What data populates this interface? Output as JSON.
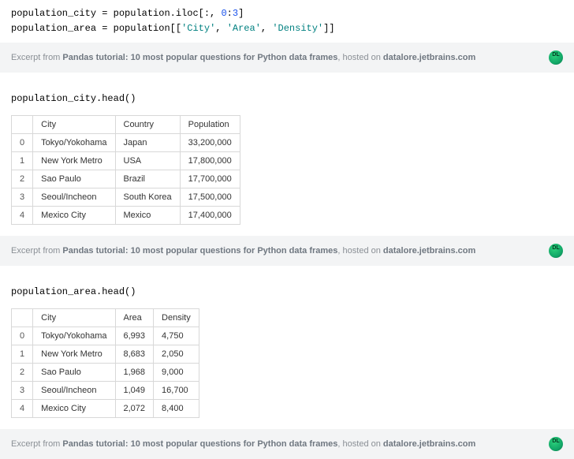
{
  "code_cell": {
    "line1_var": "population_city",
    "line1_assign": " = ",
    "line1_rhs_a": "population.iloc[:, ",
    "line1_num1": "0",
    "line1_colon": ":",
    "line1_num2": "3",
    "line1_rhs_b": "]",
    "line2_var": "population_area",
    "line2_assign": " = ",
    "line2_rhs_a": "population[[",
    "line2_str1": "'City'",
    "line2_c1": ", ",
    "line2_str2": "'Area'",
    "line2_c2": ", ",
    "line2_str3": "'Density'",
    "line2_rhs_b": "]]"
  },
  "footer": {
    "prefix": "Excerpt from ",
    "title": "Pandas tutorial: 10 most popular questions for Python data frames",
    "middle": ", hosted on ",
    "host": "datalore.jetbrains.com"
  },
  "block1": {
    "call": "population_city.head()",
    "columns": [
      "City",
      "Country",
      "Population"
    ],
    "rows": [
      {
        "idx": "0",
        "cells": [
          "Tokyo/Yokohama",
          "Japan",
          "33,200,000"
        ]
      },
      {
        "idx": "1",
        "cells": [
          "New York Metro",
          "USA",
          "17,800,000"
        ]
      },
      {
        "idx": "2",
        "cells": [
          "Sao Paulo",
          "Brazil",
          "17,700,000"
        ]
      },
      {
        "idx": "3",
        "cells": [
          "Seoul/Incheon",
          "South Korea",
          "17,500,000"
        ]
      },
      {
        "idx": "4",
        "cells": [
          "Mexico City",
          "Mexico",
          "17,400,000"
        ]
      }
    ]
  },
  "block2": {
    "call": "population_area.head()",
    "columns": [
      "City",
      "Area",
      "Density"
    ],
    "rows": [
      {
        "idx": "0",
        "cells": [
          "Tokyo/Yokohama",
          "6,993",
          "4,750"
        ]
      },
      {
        "idx": "1",
        "cells": [
          "New York Metro",
          "8,683",
          "2,050"
        ]
      },
      {
        "idx": "2",
        "cells": [
          "Sao Paulo",
          "1,968",
          "9,000"
        ]
      },
      {
        "idx": "3",
        "cells": [
          "Seoul/Incheon",
          "1,049",
          "16,700"
        ]
      },
      {
        "idx": "4",
        "cells": [
          "Mexico City",
          "2,072",
          "8,400"
        ]
      }
    ]
  }
}
